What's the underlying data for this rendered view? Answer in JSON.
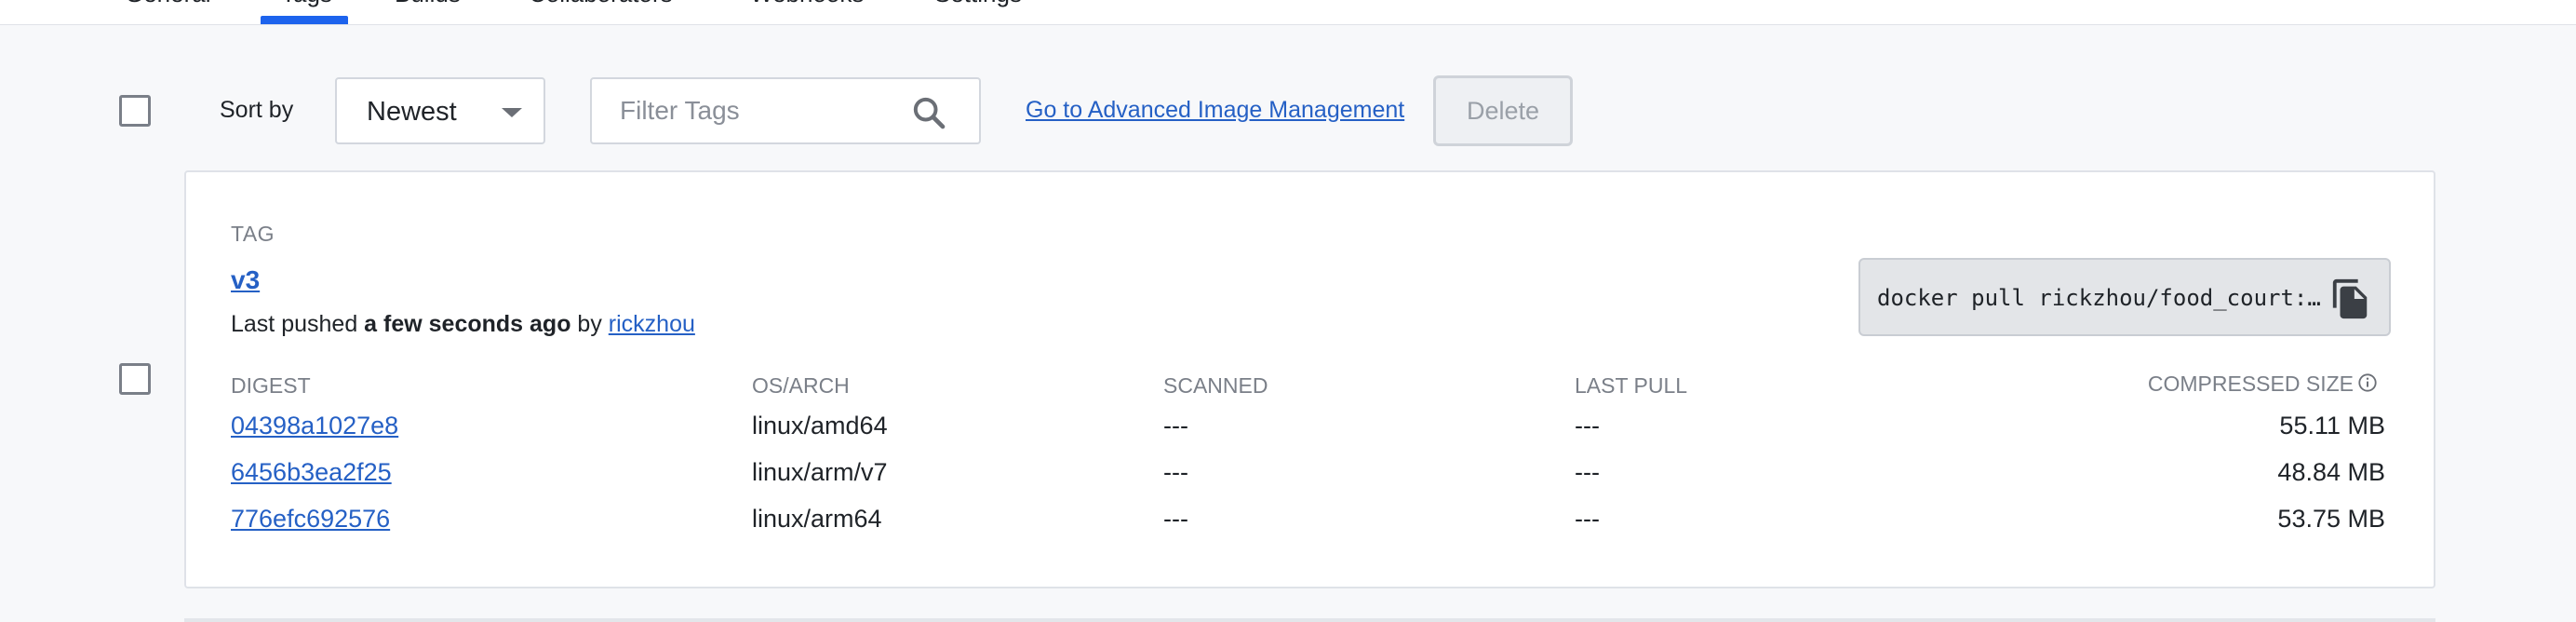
{
  "tabs": [
    {
      "label": "General"
    },
    {
      "label": "Tags",
      "active": true
    },
    {
      "label": "Builds"
    },
    {
      "label": "Collaborators"
    },
    {
      "label": "Webhooks"
    },
    {
      "label": "Settings"
    }
  ],
  "toolbar": {
    "sort_label": "Sort by",
    "sort_value": "Newest",
    "filter_placeholder": "Filter Tags",
    "advanced_link": "Go to Advanced Image Management",
    "delete_label": "Delete"
  },
  "tag_card": {
    "heading": "TAG",
    "tag_name": "v3",
    "pushed_prefix": "Last pushed",
    "pushed_time": "a few seconds ago",
    "pushed_by": "by",
    "pushed_user": "rickzhou",
    "pull_command": "docker pull rickzhou/food_court:…",
    "columns": {
      "digest": "DIGEST",
      "os_arch": "OS/ARCH",
      "scanned": "SCANNED",
      "last_pull": "LAST PULL",
      "compressed_size": "COMPRESSED SIZE"
    },
    "rows": [
      {
        "digest": "04398a1027e8",
        "os_arch": "linux/amd64",
        "scanned": "---",
        "last_pull": "---",
        "size": "55.11 MB"
      },
      {
        "digest": "6456b3ea2f25",
        "os_arch": "linux/arm/v7",
        "scanned": "---",
        "last_pull": "---",
        "size": "48.84 MB"
      },
      {
        "digest": "776efc692576",
        "os_arch": "linux/arm64",
        "scanned": "---",
        "last_pull": "---",
        "size": "53.75 MB"
      }
    ]
  },
  "colors": {
    "accent": "#1d63ed",
    "link": "#2560c5",
    "muted_text": "#7a7f88",
    "background": "#f7f8fa"
  },
  "icons": {
    "search": "search-icon",
    "copy": "copy-icon",
    "info": "info-icon",
    "dropdown": "chevron-down-icon"
  }
}
